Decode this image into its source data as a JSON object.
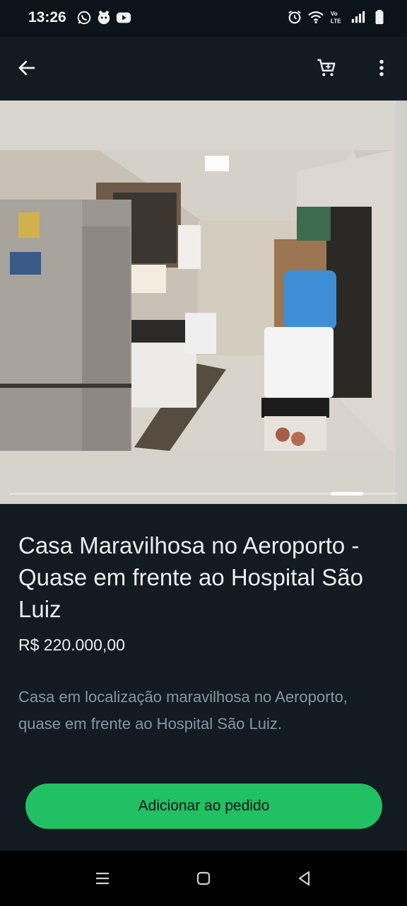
{
  "status_bar": {
    "time": "13:26",
    "left_icons": [
      "whatsapp-icon",
      "app-notification-icon",
      "youtube-icon"
    ],
    "right_icons": [
      "alarm-icon",
      "wifi-icon",
      "volte-icon",
      "signal-icon",
      "battery-icon"
    ],
    "volte_label": "Vo LTE"
  },
  "app_bar": {
    "back_icon": "back-arrow-icon",
    "cart_icon": "cart-icon",
    "more_icon": "more-vertical-icon"
  },
  "carousel": {
    "image_description_icon": "kitchen-photo",
    "current_index": 4,
    "total": 4
  },
  "product": {
    "title": "Casa Maravilhosa no Aeroporto - Quase em frente ao Hospital São Luiz",
    "price": "R$ 220.000,00",
    "description": "Casa em localização maravilhosa no Aeroporto, quase em frente ao Hospital São Luiz.",
    "add_button_label": "Adicionar ao pedido"
  },
  "colors": {
    "background": "#111b21",
    "accent": "#21c063",
    "text_primary": "#e9edef",
    "text_secondary": "#8696a0"
  },
  "nav_bar": {
    "icons": [
      "recents-icon",
      "home-icon",
      "back-triangle-icon"
    ]
  }
}
